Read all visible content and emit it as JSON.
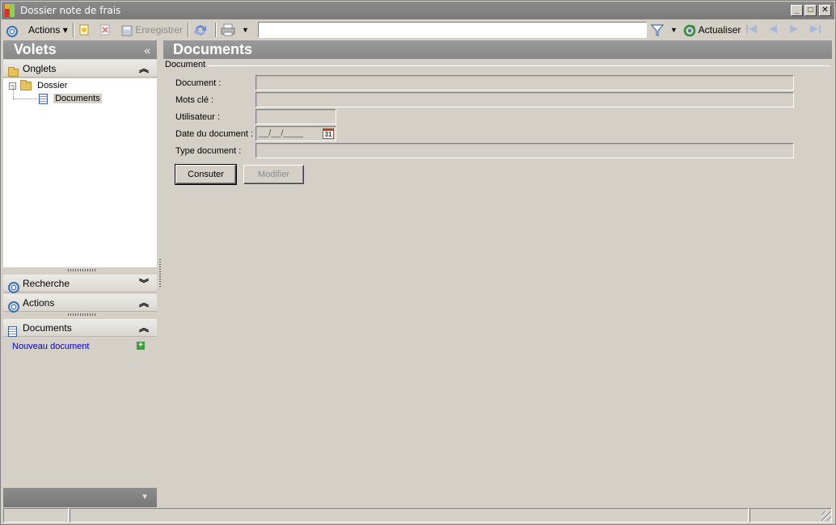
{
  "window": {
    "title": "Dossier note de frais"
  },
  "toolbar": {
    "actions_label": "Actions",
    "save_label": "Enregistrer",
    "search_value": "",
    "refresh_label": "Actualiser"
  },
  "left_panel": {
    "title": "Volets",
    "collapse_glyph": "«",
    "sections": {
      "onglets": "Onglets",
      "recherche": "Recherche",
      "actions": "Actions",
      "documents": "Documents"
    },
    "tree": {
      "root": "Dossier",
      "child": "Documents"
    },
    "new_document_link": "Nouveau document"
  },
  "main": {
    "title": "Documents",
    "group_title": "Document",
    "fields": {
      "document_label": "Document :",
      "mots_cle_label": "Mots clé :",
      "utilisateur_label": "Utilisateur :",
      "date_label": "Date du document :",
      "date_placeholder": "__/__/____",
      "type_label": "Type document :"
    },
    "calendar_day": "31",
    "buttons": {
      "consulter": "Consuter",
      "modifier": "Modifier"
    }
  },
  "colors": {
    "header_gray": "#8a8a8a",
    "panel_bg": "#d4d0c8",
    "link_blue": "#0000cc",
    "accent_blue": "#3a6fb0"
  }
}
